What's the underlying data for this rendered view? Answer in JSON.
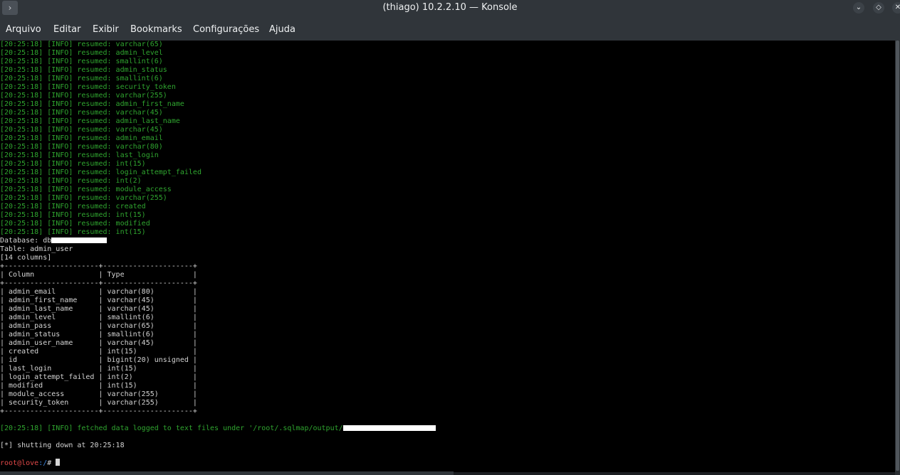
{
  "window": {
    "title": "(thiago) 10.2.2.10 — Konsole",
    "app_button": "›",
    "min_btn": "⌄",
    "max_btn": "◇",
    "close_btn": "✕"
  },
  "menu": [
    "Arquivo",
    "Editar",
    "Exibir",
    "Bookmarks",
    "Configurações",
    "Ajuda"
  ],
  "log_lines": [
    "[20:25:18] [INFO] resumed: varchar(65)",
    "[20:25:18] [INFO] resumed: admin_level",
    "[20:25:18] [INFO] resumed: smallint(6)",
    "[20:25:18] [INFO] resumed: admin_status",
    "[20:25:18] [INFO] resumed: smallint(6)",
    "[20:25:18] [INFO] resumed: security_token",
    "[20:25:18] [INFO] resumed: varchar(255)",
    "[20:25:18] [INFO] resumed: admin_first_name",
    "[20:25:18] [INFO] resumed: varchar(45)",
    "[20:25:18] [INFO] resumed: admin_last_name",
    "[20:25:18] [INFO] resumed: varchar(45)",
    "[20:25:18] [INFO] resumed: admin_email",
    "[20:25:18] [INFO] resumed: varchar(80)",
    "[20:25:18] [INFO] resumed: last_login",
    "[20:25:18] [INFO] resumed: int(15)",
    "[20:25:18] [INFO] resumed: login_attempt_failed",
    "[20:25:18] [INFO] resumed: int(2)",
    "[20:25:18] [INFO] resumed: module_access",
    "[20:25:18] [INFO] resumed: varchar(255)",
    "[20:25:18] [INFO] resumed: created",
    "[20:25:18] [INFO] resumed: int(15)",
    "[20:25:18] [INFO] resumed: modified",
    "[20:25:18] [INFO] resumed: int(15)"
  ],
  "database_line": "Database: db",
  "table_line": "Table: admin_user",
  "columns_count_line": "[14 columns]",
  "table_border": "+----------------------+---------------------+",
  "table_header": "| Column               | Type                |",
  "table_rows": [
    "| admin_email          | varchar(80)         |",
    "| admin_first_name     | varchar(45)         |",
    "| admin_last_name      | varchar(45)         |",
    "| admin_level          | smallint(6)         |",
    "| admin_pass           | varchar(65)         |",
    "| admin_status         | smallint(6)         |",
    "| admin_user_name      | varchar(45)         |",
    "| created              | int(15)             |",
    "| id                   | bigint(20) unsigned |",
    "| last_login           | int(15)             |",
    "| login_attempt_failed | int(2)              |",
    "| modified             | int(15)             |",
    "| module_access        | varchar(255)        |",
    "| security_token       | varchar(255)        |"
  ],
  "fetched_line": "[20:25:18] [INFO] fetched data logged to text files under '/root/.sqlmap/output/",
  "shutdown_line": "[*] shutting down at 20:25:18",
  "prompt": {
    "user_host": "root@love",
    "path": ":/",
    "symbol": "# "
  },
  "colors": {
    "log": "#2fa52f",
    "text": "#d4d4d4",
    "prompt_user": "#e04848",
    "prompt_path": "#3b86e0",
    "chrome": "#30353a"
  }
}
